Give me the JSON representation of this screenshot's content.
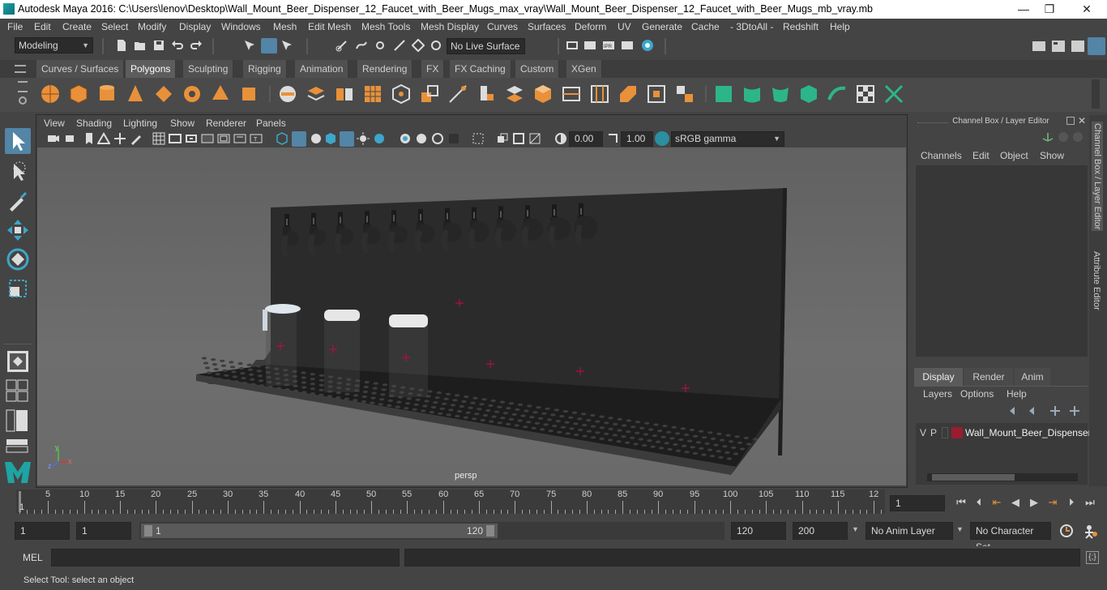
{
  "window": {
    "title": "Autodesk Maya 2016: C:\\Users\\lenov\\Desktop\\Wall_Mount_Beer_Dispenser_12_Faucet_with_Beer_Mugs_max_vray\\Wall_Mount_Beer_Dispenser_12_Faucet_with_Beer_Mugs_mb_vray.mb",
    "minimize": "—",
    "restore": "❐",
    "close": "✕"
  },
  "menubar": [
    "File",
    "Edit",
    "Create",
    "Select",
    "Modify",
    "Display",
    "Windows",
    "Mesh",
    "Edit Mesh",
    "Mesh Tools",
    "Mesh Display",
    "Curves",
    "Surfaces",
    "Deform",
    "UV",
    "Generate",
    "Cache",
    "- 3DtoAll -",
    "Redshift",
    "Help"
  ],
  "statusline": {
    "mode": "Modeling",
    "live_surface": "No Live Surface"
  },
  "shelf_tabs": [
    "Curves / Surfaces",
    "Polygons",
    "Sculpting",
    "Rigging",
    "Animation",
    "Rendering",
    "FX",
    "FX Caching",
    "Custom",
    "XGen"
  ],
  "shelf_active": "Polygons",
  "viewport": {
    "menu": [
      "View",
      "Shading",
      "Lighting",
      "Show",
      "Renderer",
      "Panels"
    ],
    "exposure": "0.00",
    "gamma": "1.00",
    "color_space": "sRGB gamma",
    "camera_label": "persp",
    "axis_y": "y",
    "axis_x": "x",
    "axis_z": "z"
  },
  "channel_box": {
    "title": "Channel Box / Layer Editor",
    "menu": [
      "Channels",
      "Edit",
      "Object",
      "Show"
    ],
    "layer_tabs": [
      "Display",
      "Render",
      "Anim"
    ],
    "layer_menu": [
      "Layers",
      "Options",
      "Help"
    ],
    "layer": {
      "v": "V",
      "p": "P",
      "name": "Wall_Mount_Beer_Dispenser",
      "color": "#9b1b30"
    }
  },
  "side_tabs": [
    "Channel Box / Layer Editor",
    "Attribute Editor"
  ],
  "timeline": {
    "ticks": [
      "5",
      "10",
      "15",
      "20",
      "25",
      "30",
      "35",
      "40",
      "45",
      "50",
      "55",
      "60",
      "65",
      "70",
      "75",
      "80",
      "85",
      "90",
      "95",
      "100",
      "105",
      "110",
      "115",
      "12"
    ],
    "start_marker": "1",
    "current_frame": "1"
  },
  "range": {
    "start": "1",
    "anim_start": "1",
    "slider_start": "1",
    "slider_end": "120",
    "end": "120",
    "anim_end": "200",
    "anim_layer": "No Anim Layer",
    "character_set": "No Character Set"
  },
  "mel": {
    "label": "MEL"
  },
  "help_line": "Select Tool: select an object",
  "accent": "#5285a6",
  "shelf_icon_color": "#e8913a"
}
